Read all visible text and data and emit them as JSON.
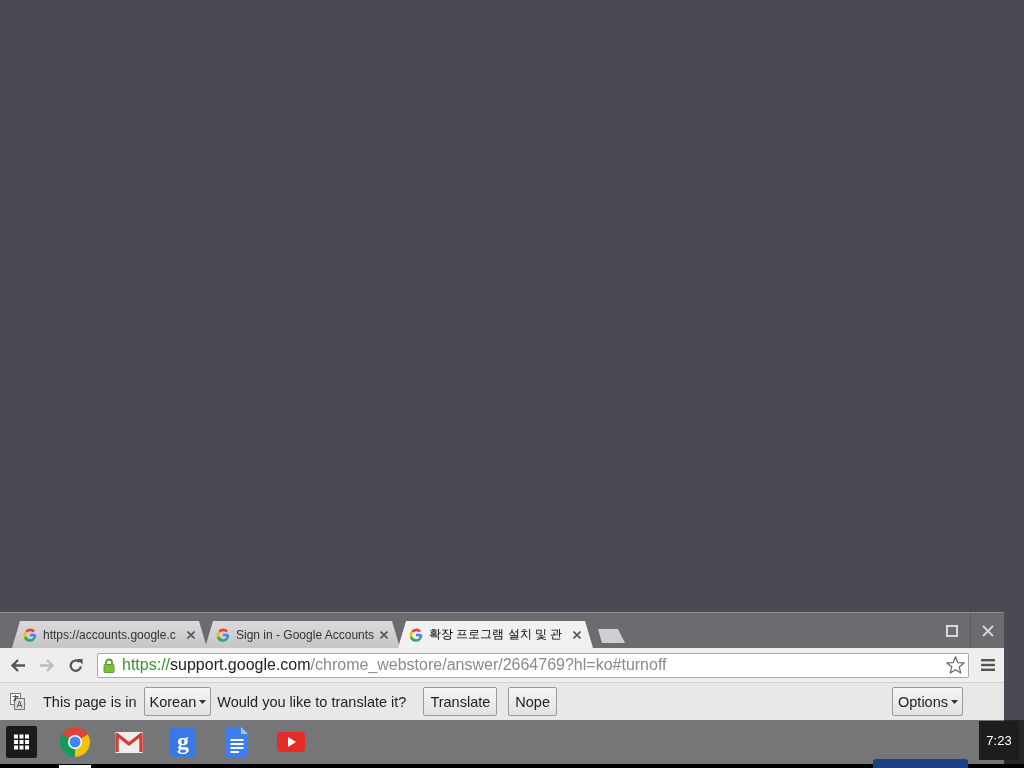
{
  "browser": {
    "tabs": [
      {
        "title": "https://accounts.google.c",
        "selected": false
      },
      {
        "title": "Sign in - Google Accounts",
        "selected": false
      },
      {
        "title": "확장 프로그램 설치 및 관",
        "selected": true
      }
    ],
    "toolbar": {
      "nav": [
        {
          "kind": "back",
          "disabled": false
        },
        {
          "kind": "forward",
          "disabled": true
        },
        {
          "kind": "reload",
          "disabled": false
        }
      ],
      "address": {
        "secure": true,
        "scheme": "https://",
        "host": "support.google.com",
        "path": "/chrome_webstore/answer/2664769?hl=ko#turnoff"
      },
      "bookmarked": false
    },
    "translate_bar": {
      "message": "This page is in",
      "language": "Korean",
      "question": "Would you like to translate it?",
      "buttons": [
        "Translate",
        "Nope"
      ],
      "options": "Options"
    }
  },
  "shelf": {
    "apps": [
      {
        "kind": "chrome",
        "running": true
      },
      {
        "kind": "gmail",
        "running": false
      },
      {
        "kind": "google",
        "label": "g",
        "running": false
      },
      {
        "kind": "docs",
        "running": false
      },
      {
        "kind": "youtube",
        "running": false
      }
    ],
    "clock": "7:23"
  }
}
